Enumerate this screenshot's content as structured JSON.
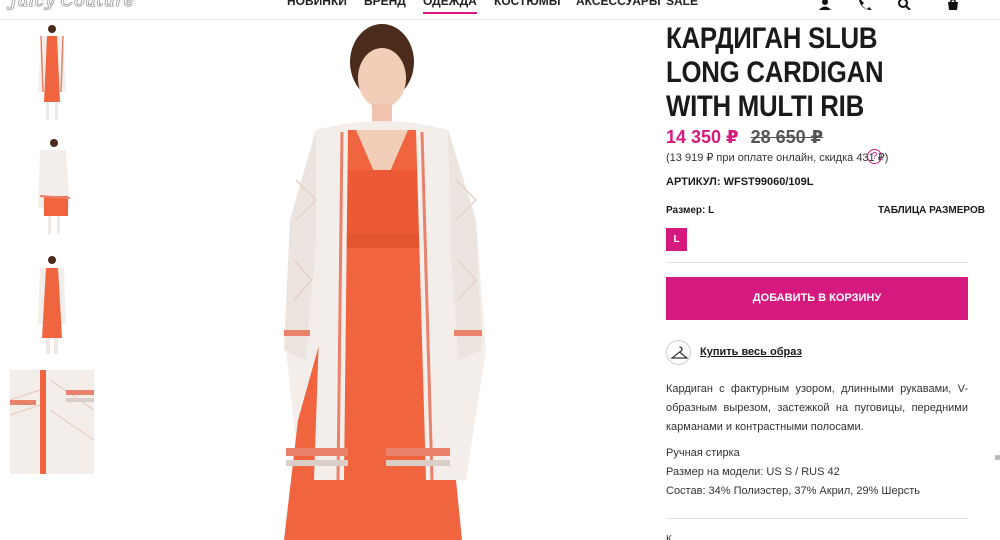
{
  "header": {
    "logo": "Juicy Couture",
    "nav": [
      {
        "label": "НОВИНКИ",
        "active": false
      },
      {
        "label": "БРЕНД",
        "active": false
      },
      {
        "label": "ОДЕЖДА",
        "active": true
      },
      {
        "label": "КОСТЮМЫ",
        "active": false
      },
      {
        "label": "АКСЕССУАРЫ",
        "active": false
      },
      {
        "label": "SALE",
        "active": false
      }
    ],
    "icons": [
      "user-icon",
      "phone-icon",
      "search-icon",
      "cart-icon"
    ]
  },
  "gallery": {
    "thumbnails": [
      "thumbnail-front",
      "thumbnail-side",
      "thumbnail-front-2",
      "thumbnail-detail"
    ],
    "main_image": "main-product-image"
  },
  "product": {
    "title": "КАРДИГАН SLUB LONG CARDIGAN WITH MULTI RIB",
    "price": "14 350 ₽",
    "old_price": "28 650 ₽",
    "online_note": "(13 919 ₽ при оплате онлайн, скидка 431 ₽)",
    "help_icon": "?",
    "sku": "АРТИКУЛ: WFST99060/109L",
    "size_label": "Размер: L",
    "size_table": "ТАБЛИЦА РАЗМЕРОВ",
    "sizes": [
      "L"
    ],
    "selected_size": "L",
    "add_to_cart": "ДОБАВИТЬ В КОРЗИНУ",
    "buy_look": "Купить весь образ",
    "description": "Кардиган с фактурным узором, длинными рукавами, V-образным вырезом, застежкой на пуговицы, передними карманами и контрастными полосами.",
    "care": "Ручная стирка",
    "model_size": "Размер на модели: US S / RUS 42",
    "composition": "Состав: 34% Полиэстер, 37% Акрил, 29% Шерсть",
    "bottom_partial": "К"
  },
  "colors": {
    "accent": "#d6197e",
    "dress": "#f0643f",
    "cardigan": "#f4eeea",
    "stripe": "#e8826a"
  }
}
